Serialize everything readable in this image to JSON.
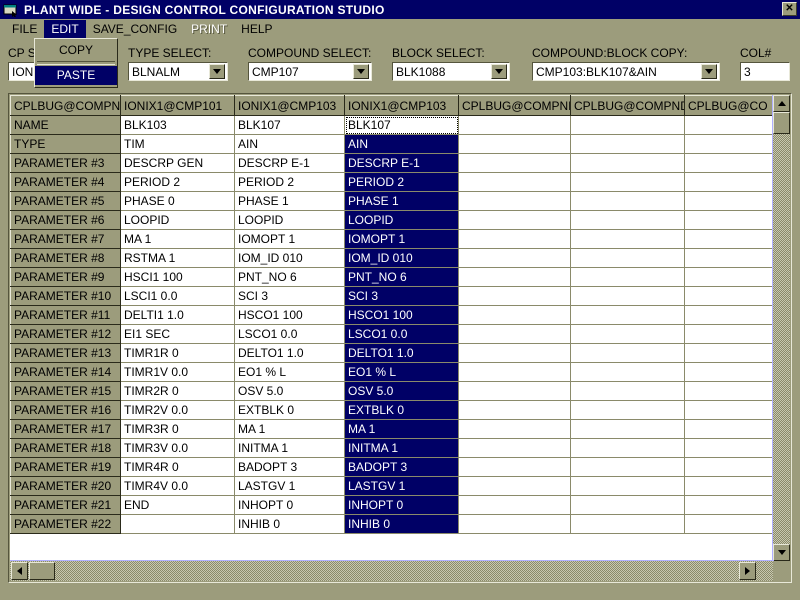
{
  "window": {
    "title": "PLANT WIDE - DESIGN CONTROL CONFIGURATION STUDIO",
    "close_label": "✕",
    "icon": "app-window-icon",
    "titlebar_color": "#000066",
    "face_color": "#9c9c7c",
    "selection_color": "#000066"
  },
  "menubar": {
    "items": [
      {
        "label": "FILE",
        "state": "normal"
      },
      {
        "label": "EDIT",
        "state": "active"
      },
      {
        "label": "SAVE_CONFIG",
        "state": "normal"
      },
      {
        "label": "PRINT",
        "state": "disabled"
      },
      {
        "label": "HELP",
        "state": "normal"
      }
    ]
  },
  "edit_menu": {
    "open": true,
    "items": [
      {
        "label": "COPY",
        "highlighted": false
      },
      {
        "label": "PASTE",
        "highlighted": true
      }
    ]
  },
  "selectors": {
    "cp_select": {
      "label": "CP S",
      "value": "IONI"
    },
    "type_select": {
      "label": "TYPE SELECT:",
      "value": "BLNALM"
    },
    "compound_select": {
      "label": "COMPOUND SELECT:",
      "value": "CMP107"
    },
    "block_select": {
      "label": "BLOCK SELECT:",
      "value": "BLK1088"
    },
    "compound_block_copy": {
      "label": "COMPOUND:BLOCK COPY:",
      "value": "CMP103:BLK107&AIN"
    },
    "col_number": {
      "label": "COL#",
      "value": "3"
    }
  },
  "grid": {
    "headers": [
      "CPLBUG@COMPND",
      "IONIX1@CMP101",
      "IONIX1@CMP103",
      "IONIX1@CMP103",
      "CPLBUG@COMPND",
      "CPLBUG@COMPND",
      "CPLBUG@CO"
    ],
    "selected_column_index": 3,
    "focus_cell": {
      "row": 0,
      "col": 3
    },
    "rows": [
      {
        "label": "NAME",
        "cells": [
          "BLK103",
          "BLK107",
          "BLK107",
          "",
          "",
          ""
        ]
      },
      {
        "label": "TYPE",
        "cells": [
          "TIM",
          "AIN",
          "AIN",
          "",
          "",
          ""
        ]
      },
      {
        "label": "PARAMETER #3",
        "cells": [
          "DESCRP GEN",
          "DESCRP E-1",
          "DESCRP E-1",
          "",
          "",
          ""
        ]
      },
      {
        "label": "PARAMETER #4",
        "cells": [
          "PERIOD 2",
          "PERIOD 2",
          "PERIOD 2",
          "",
          "",
          ""
        ]
      },
      {
        "label": "PARAMETER #5",
        "cells": [
          "PHASE 0",
          "PHASE 1",
          "PHASE 1",
          "",
          "",
          ""
        ]
      },
      {
        "label": "PARAMETER #6",
        "cells": [
          "LOOPID",
          "LOOPID",
          "LOOPID",
          "",
          "",
          ""
        ]
      },
      {
        "label": "PARAMETER #7",
        "cells": [
          "MA 1",
          "IOMOPT 1",
          "IOMOPT 1",
          "",
          "",
          ""
        ]
      },
      {
        "label": "PARAMETER #8",
        "cells": [
          "RSTMA 1",
          "IOM_ID 010",
          "IOM_ID 010",
          "",
          "",
          ""
        ]
      },
      {
        "label": "PARAMETER #9",
        "cells": [
          "HSCI1 100",
          "PNT_NO 6",
          "PNT_NO 6",
          "",
          "",
          ""
        ]
      },
      {
        "label": "PARAMETER #10",
        "cells": [
          "LSCI1 0.0",
          "SCI 3",
          "SCI 3",
          "",
          "",
          ""
        ]
      },
      {
        "label": "PARAMETER #11",
        "cells": [
          "DELTI1 1.0",
          "HSCO1 100",
          "HSCO1 100",
          "",
          "",
          ""
        ]
      },
      {
        "label": "PARAMETER #12",
        "cells": [
          "EI1 SEC",
          "LSCO1 0.0",
          "LSCO1 0.0",
          "",
          "",
          ""
        ]
      },
      {
        "label": "PARAMETER #13",
        "cells": [
          "TIMR1R 0",
          "DELTO1 1.0",
          "DELTO1 1.0",
          "",
          "",
          ""
        ]
      },
      {
        "label": "PARAMETER #14",
        "cells": [
          "TIMR1V 0.0",
          "EO1 % L",
          "EO1 % L",
          "",
          "",
          ""
        ]
      },
      {
        "label": "PARAMETER #15",
        "cells": [
          "TIMR2R 0",
          "OSV 5.0",
          "OSV 5.0",
          "",
          "",
          ""
        ]
      },
      {
        "label": "PARAMETER #16",
        "cells": [
          "TIMR2V 0.0",
          "EXTBLK 0",
          "EXTBLK 0",
          "",
          "",
          ""
        ]
      },
      {
        "label": "PARAMETER #17",
        "cells": [
          "TIMR3R 0",
          "MA 1",
          "MA 1",
          "",
          "",
          ""
        ]
      },
      {
        "label": "PARAMETER #18",
        "cells": [
          "TIMR3V 0.0",
          "INITMA 1",
          "INITMA 1",
          "",
          "",
          ""
        ]
      },
      {
        "label": "PARAMETER #19",
        "cells": [
          "TIMR4R 0",
          "BADOPT 3",
          "BADOPT 3",
          "",
          "",
          ""
        ]
      },
      {
        "label": "PARAMETER #20",
        "cells": [
          "TIMR4V 0.0",
          "LASTGV 1",
          "LASTGV 1",
          "",
          "",
          ""
        ]
      },
      {
        "label": "PARAMETER #21",
        "cells": [
          "END",
          "INHOPT 0",
          "INHOPT 0",
          "",
          "",
          ""
        ]
      },
      {
        "label": "PARAMETER #22",
        "cells": [
          "",
          "INHIB 0",
          "INHIB 0",
          "",
          "",
          ""
        ]
      }
    ]
  },
  "scrollbars": {
    "vertical": {
      "up_arrow": "▲",
      "down_arrow": "▼"
    },
    "horizontal": {
      "left_arrow": "◄",
      "right_arrow": "►"
    }
  }
}
